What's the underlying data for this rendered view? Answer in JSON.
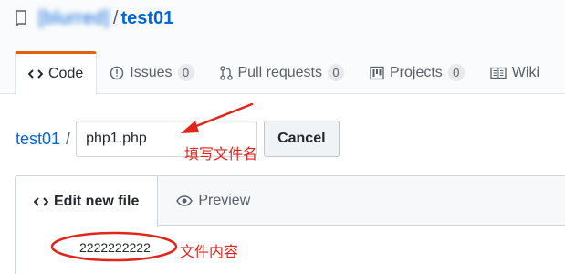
{
  "header": {
    "owner": "[blurred]",
    "separator": "/",
    "repo_name": "test01"
  },
  "tabs": [
    {
      "label": "Code",
      "icon": "code-icon",
      "active": true
    },
    {
      "label": "Issues",
      "icon": "issue-icon",
      "count": "0"
    },
    {
      "label": "Pull requests",
      "icon": "pull-request-icon",
      "count": "0"
    },
    {
      "label": "Projects",
      "icon": "project-icon",
      "count": "0"
    },
    {
      "label": "Wiki",
      "icon": "book-icon"
    }
  ],
  "path": {
    "repo_link": "test01",
    "separator": "/",
    "filename_value": "php1.php",
    "cancel_label": "Cancel"
  },
  "editor": {
    "tab_edit": "Edit new file",
    "tab_preview": "Preview",
    "content_line": "2222222222"
  },
  "annotations": {
    "filename_note": "填写文件名",
    "content_note": "文件内容",
    "color": "#e0251b"
  },
  "colors": {
    "link": "#0366d6",
    "active_tab_border": "#e36209"
  }
}
